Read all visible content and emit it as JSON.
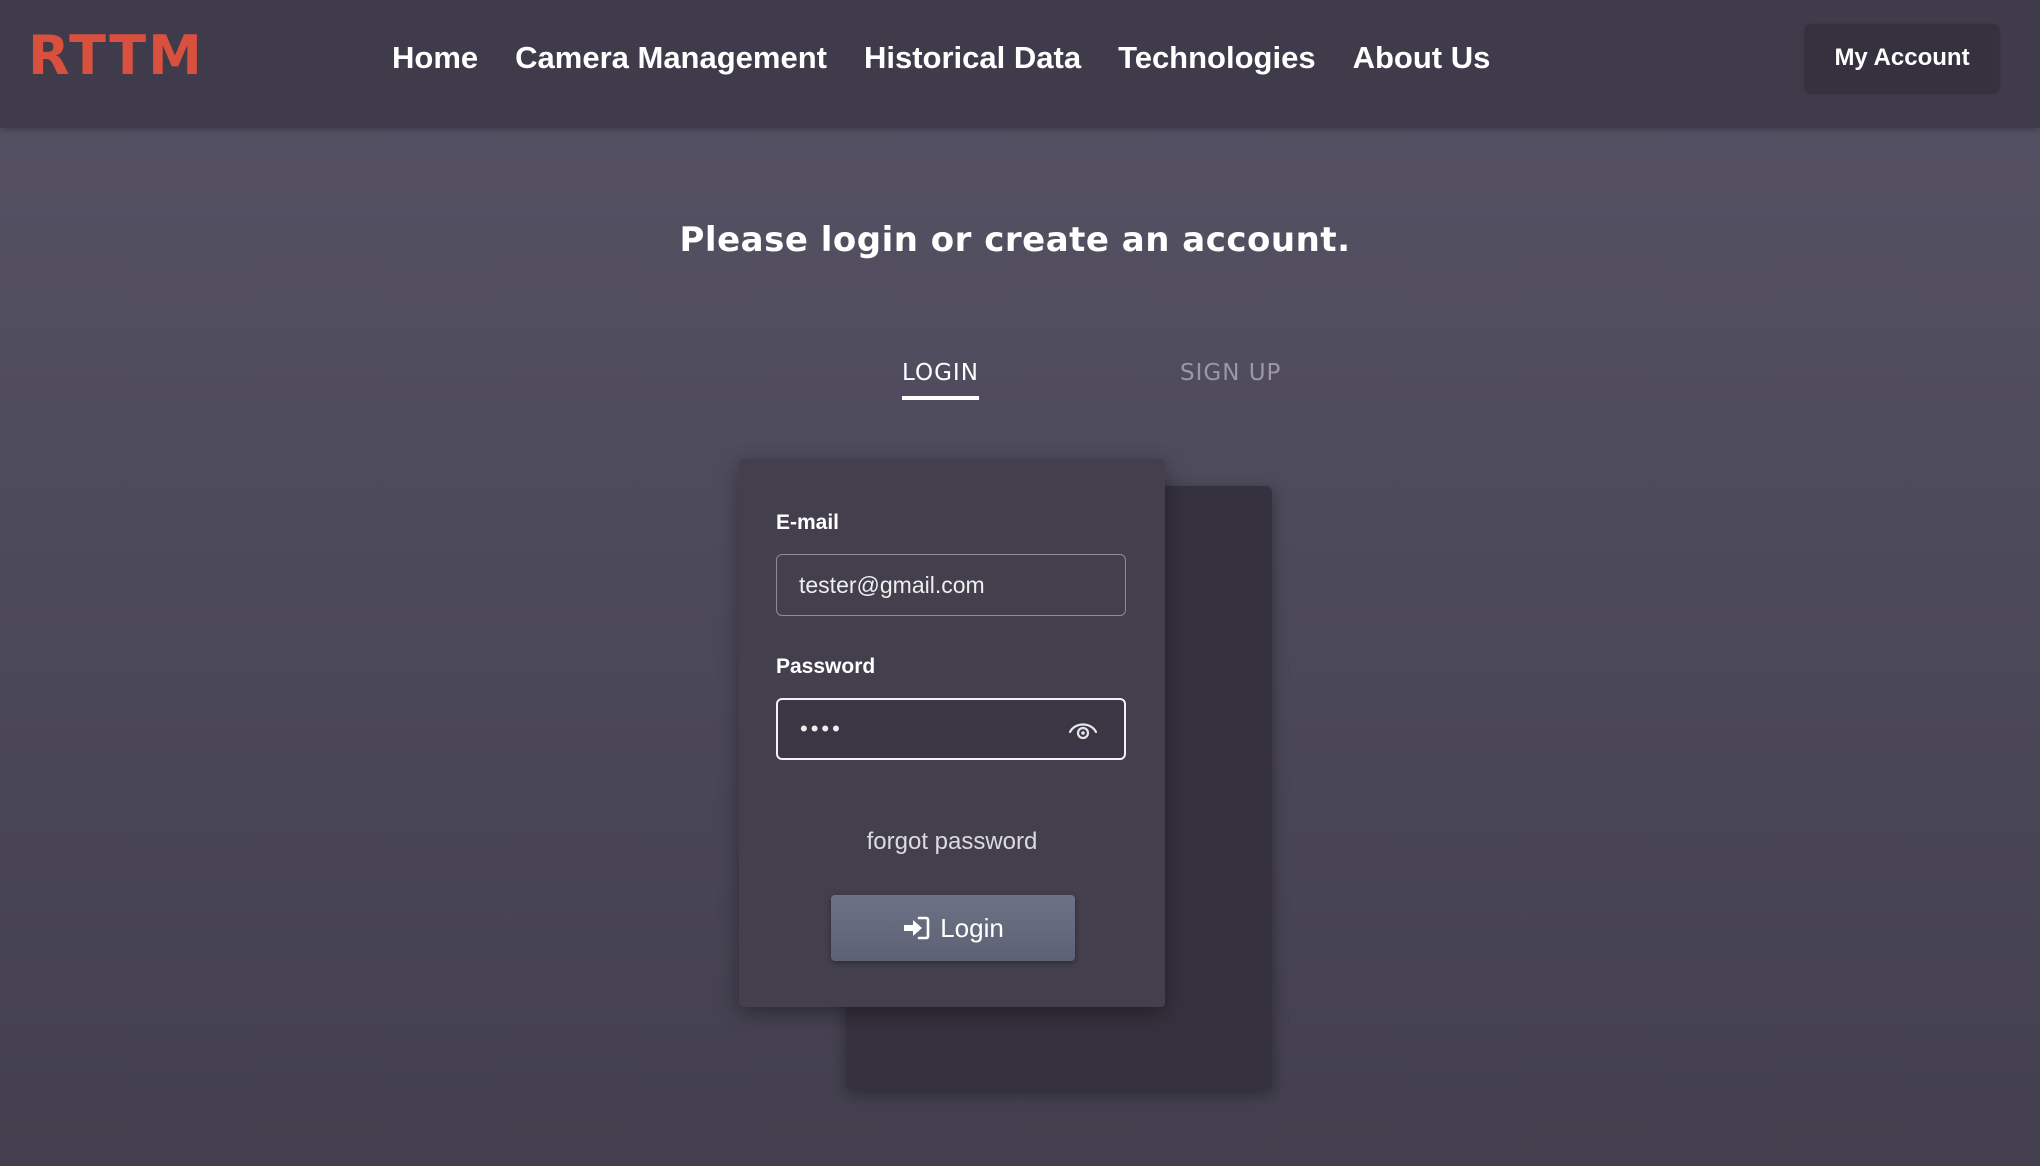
{
  "brand": {
    "logo_text": "RTTM",
    "accent_color": "#d9503f"
  },
  "nav": {
    "links": [
      "Home",
      "Camera Management",
      "Historical Data",
      "Technologies",
      "About Us"
    ],
    "account_label": "My Account"
  },
  "page": {
    "heading": "Please login or create an account."
  },
  "tabs": {
    "active": "LOGIN",
    "items": [
      "LOGIN",
      "SIGN UP"
    ]
  },
  "login_form": {
    "email_label": "E-mail",
    "email_value": "tester@gmail.com",
    "password_label": "Password",
    "password_masked": "••••",
    "password_toggle_icon": "eye-icon",
    "forgot_label": "forgot password",
    "submit_label": "Login",
    "submit_icon": "sign-in-icon"
  }
}
